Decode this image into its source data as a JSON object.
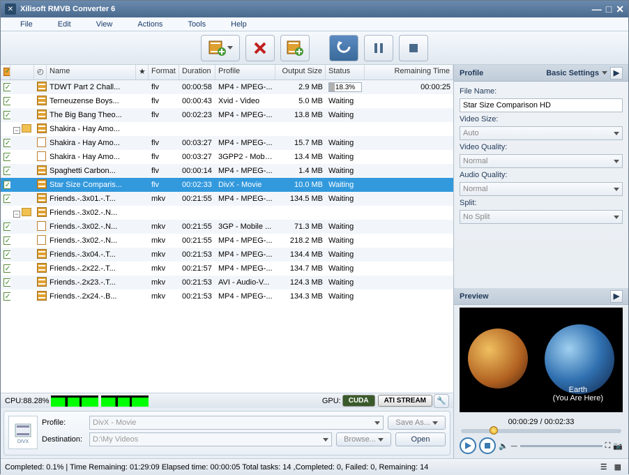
{
  "window": {
    "title": "Xilisoft RMVB Converter 6"
  },
  "menu": [
    "File",
    "Edit",
    "View",
    "Actions",
    "Tools",
    "Help"
  ],
  "columns": {
    "name": "Name",
    "format": "Format",
    "duration": "Duration",
    "profile": "Profile",
    "output": "Output Size",
    "status": "Status",
    "remaining": "Remaining Time"
  },
  "rows": [
    {
      "exp": "",
      "icon": "film",
      "name": "TDWT Part 2 Chall...",
      "fmt": "flv",
      "dur": "00:00:58",
      "prof": "MP4 - MPEG-...",
      "out": "2.9 MB",
      "stat": "progress",
      "statText": "18.3%",
      "rem": "00:00:25",
      "chk": true,
      "indent": 0
    },
    {
      "exp": "",
      "icon": "film",
      "name": "Terneuzense Boys...",
      "fmt": "flv",
      "dur": "00:00:43",
      "prof": "Xvid - Video",
      "out": "5.0 MB",
      "stat": "Waiting",
      "rem": "",
      "chk": true,
      "indent": 0
    },
    {
      "exp": "",
      "icon": "film",
      "name": "The Big Bang Theo...",
      "fmt": "flv",
      "dur": "00:02:23",
      "prof": "MP4 - MPEG-...",
      "out": "13.8 MB",
      "stat": "Waiting",
      "rem": "",
      "chk": true,
      "indent": 0
    },
    {
      "exp": "minus",
      "icon": "folder",
      "name": "Shakira - Hay Amo...",
      "fmt": "",
      "dur": "",
      "prof": "",
      "out": "",
      "stat": "",
      "rem": "",
      "chk": false,
      "indent": 0,
      "isFolder": true
    },
    {
      "exp": "",
      "icon": "doc",
      "name": "Shakira - Hay Amo...",
      "fmt": "flv",
      "dur": "00:03:27",
      "prof": "MP4 - MPEG-...",
      "out": "15.7 MB",
      "stat": "Waiting",
      "rem": "",
      "chk": true,
      "indent": 1
    },
    {
      "exp": "",
      "icon": "doc",
      "name": "Shakira - Hay Amo...",
      "fmt": "flv",
      "dur": "00:03:27",
      "prof": "3GPP2 - Mobil...",
      "out": "13.4 MB",
      "stat": "Waiting",
      "rem": "",
      "chk": true,
      "indent": 1
    },
    {
      "exp": "",
      "icon": "film",
      "name": "Spaghetti Carbon...",
      "fmt": "flv",
      "dur": "00:00:14",
      "prof": "MP4 - MPEG-...",
      "out": "1.4 MB",
      "stat": "Waiting",
      "rem": "",
      "chk": true,
      "indent": 0
    },
    {
      "exp": "",
      "icon": "film",
      "name": "Star Size Comparis...",
      "fmt": "flv",
      "dur": "00:02:33",
      "prof": "DivX - Movie",
      "out": "10.0 MB",
      "stat": "Waiting",
      "rem": "",
      "chk": true,
      "indent": 0,
      "sel": true
    },
    {
      "exp": "",
      "icon": "film",
      "name": "Friends.-.3x01.-.T...",
      "fmt": "mkv",
      "dur": "00:21:55",
      "prof": "MP4 - MPEG-...",
      "out": "134.5 MB",
      "stat": "Waiting",
      "rem": "",
      "chk": true,
      "indent": 0
    },
    {
      "exp": "minus",
      "icon": "folder",
      "name": "Friends.-.3x02.-.N...",
      "fmt": "",
      "dur": "",
      "prof": "",
      "out": "",
      "stat": "",
      "rem": "",
      "chk": false,
      "indent": 0,
      "isFolder": true
    },
    {
      "exp": "",
      "icon": "doc",
      "name": "Friends.-.3x02.-.N...",
      "fmt": "mkv",
      "dur": "00:21:55",
      "prof": "3GP - Mobile ...",
      "out": "71.3 MB",
      "stat": "Waiting",
      "rem": "",
      "chk": true,
      "indent": 1
    },
    {
      "exp": "",
      "icon": "doc",
      "name": "Friends.-.3x02.-.N...",
      "fmt": "mkv",
      "dur": "00:21:55",
      "prof": "MP4 - MPEG-...",
      "out": "218.2 MB",
      "stat": "Waiting",
      "rem": "",
      "chk": true,
      "indent": 1
    },
    {
      "exp": "",
      "icon": "film",
      "name": "Friends.-.3x04.-.T...",
      "fmt": "mkv",
      "dur": "00:21:53",
      "prof": "MP4 - MPEG-...",
      "out": "134.4 MB",
      "stat": "Waiting",
      "rem": "",
      "chk": true,
      "indent": 0
    },
    {
      "exp": "",
      "icon": "film",
      "name": "Friends.-.2x22.-.T...",
      "fmt": "mkv",
      "dur": "00:21:57",
      "prof": "MP4 - MPEG-...",
      "out": "134.7 MB",
      "stat": "Waiting",
      "rem": "",
      "chk": true,
      "indent": 0
    },
    {
      "exp": "",
      "icon": "film",
      "name": "Friends.-.2x23.-.T...",
      "fmt": "mkv",
      "dur": "00:21:53",
      "prof": "AVI - Audio-V...",
      "out": "124.3 MB",
      "stat": "Waiting",
      "rem": "",
      "chk": true,
      "indent": 0
    },
    {
      "exp": "",
      "icon": "film",
      "name": "Friends.-.2x24.-.B...",
      "fmt": "mkv",
      "dur": "00:21:53",
      "prof": "MP4 - MPEG-...",
      "out": "134.3 MB",
      "stat": "Waiting",
      "rem": "",
      "chk": true,
      "indent": 0
    }
  ],
  "cpu": {
    "label": "CPU:",
    "value": "88.28%"
  },
  "gpu": {
    "label": "GPU:",
    "cuda": "CUDA",
    "ati": "ATI STREAM"
  },
  "bottom": {
    "profileLabel": "Profile:",
    "profileValue": "DivX - Movie",
    "saveAs": "Save As...",
    "destLabel": "Destination:",
    "destValue": "D:\\My Videos",
    "browse": "Browse...",
    "open": "Open"
  },
  "footer": {
    "text": "Completed: 0.1% | Time Remaining: 01:29:09 Elapsed time: 00:00:05 Total tasks: 14 ,Completed: 0, Failed: 0, Remaining: 14"
  },
  "profile": {
    "title": "Profile",
    "mode": "Basic Settings",
    "fields": {
      "fileNameLabel": "File Name:",
      "fileName": "Star Size Comparison HD",
      "videoSizeLabel": "Video Size:",
      "videoSize": "Auto",
      "videoQualityLabel": "Video Quality:",
      "videoQuality": "Normal",
      "audioQualityLabel": "Audio Quality:",
      "audioQuality": "Normal",
      "splitLabel": "Split:",
      "split": "No Split"
    }
  },
  "preview": {
    "title": "Preview",
    "time": "00:00:29 / 00:02:33",
    "earthLabel": "Earth",
    "earthSub": "(You Are Here)"
  }
}
